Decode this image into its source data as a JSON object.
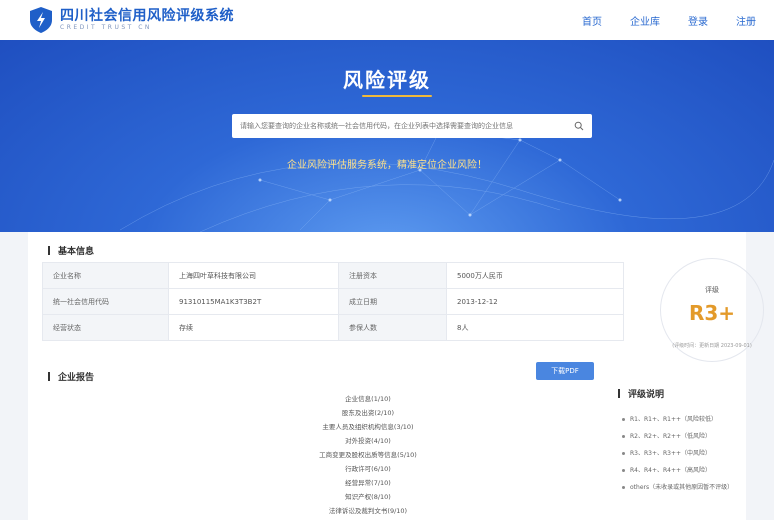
{
  "brand": {
    "name": "四川社会信用风险评级系统",
    "subtitle": "CREDIT TRUST CN",
    "accent": "#1f5fc8"
  },
  "nav": {
    "items": [
      "首页",
      "企业库",
      "登录",
      "注册"
    ]
  },
  "hero": {
    "title": "风险评级",
    "search_placeholder": "请输入您要查询的企业名称或统一社会信用代码，在企业列表中选择需要查询的企业信息",
    "tagline": "企业风险评估服务系统，精准定位企业风险！"
  },
  "basic_info": {
    "title": "基本信息",
    "rows": [
      {
        "label1": "企业名称",
        "value1": "上海四叶草科技有限公司",
        "label2": "注册资本",
        "value2": "5000万人民币"
      },
      {
        "label1": "统一社会信用代码",
        "value1": "91310115MA1K3T3B2T",
        "label2": "成立日期",
        "value2": "2013-12-12"
      },
      {
        "label1": "经营状态",
        "value1": "存续",
        "label2": "参保人数",
        "value2": "8人"
      }
    ]
  },
  "rating": {
    "label": "评级",
    "value": "R3+",
    "footer": "(评级时间：更新日期 2023-09-01)",
    "value_color": "#e39a2a"
  },
  "report": {
    "title": "企业报告",
    "pdf_button": "下载PDF",
    "items": [
      "企业信息(1/10)",
      "股东及出资(2/10)",
      "主要人员及组织机构信息(3/10)",
      "对外投资(4/10)",
      "工商变更及股权出质等信息(5/10)",
      "行政许可(6/10)",
      "经营异常(7/10)",
      "知识产权(8/10)",
      "法律诉讼及裁判文书(9/10)"
    ]
  },
  "legend": {
    "title": "评级说明",
    "items": [
      "R1、R1+、R1++（风险较低）",
      "R2、R2+、R2++（低风险）",
      "R3、R3+、R3++（中风险）",
      "R4、R4+、R4++（高风险）",
      "others（未收录或其他原因暂不评级）"
    ]
  }
}
